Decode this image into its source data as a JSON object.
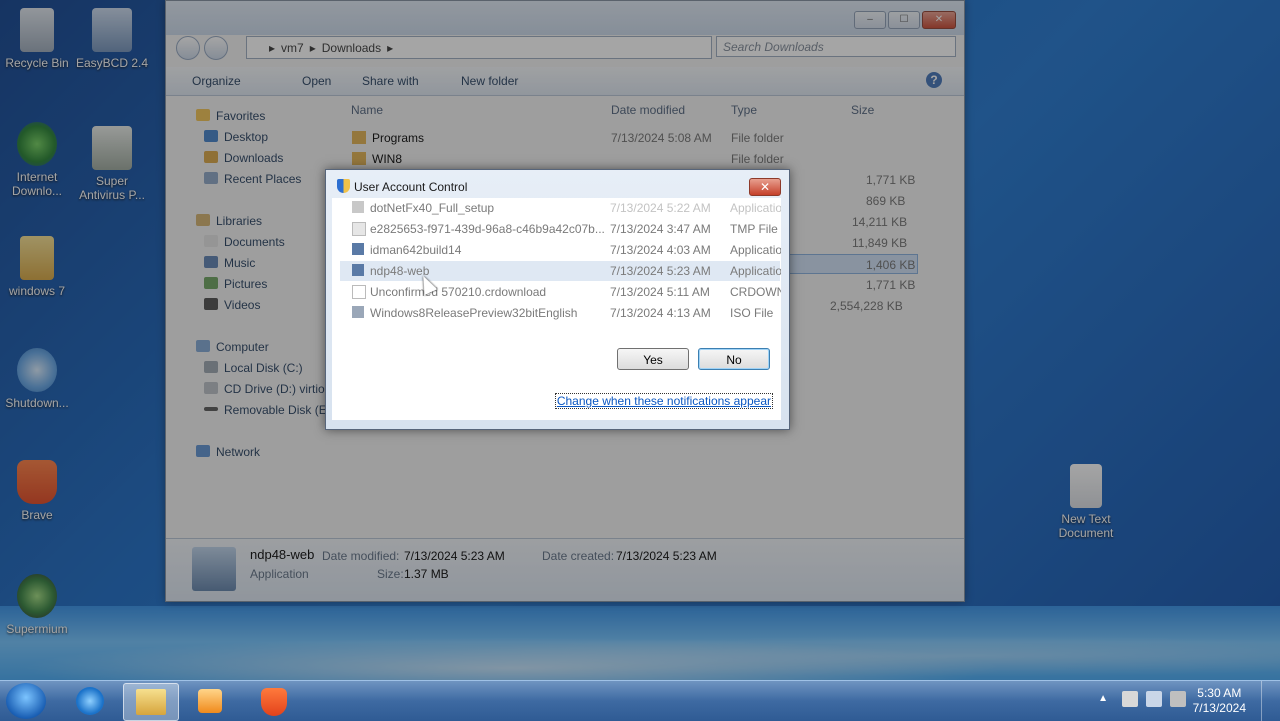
{
  "desktop": {
    "icons": [
      {
        "label": "Recycle Bin"
      },
      {
        "label": "EasyBCD 2.4"
      },
      {
        "label": "Internet Downlo..."
      },
      {
        "label": "Super Antivirus P..."
      },
      {
        "label": "windows 7"
      },
      {
        "label": "Shutdown..."
      },
      {
        "label": "Brave"
      },
      {
        "label": "Supermium"
      },
      {
        "label": "New Text Document"
      }
    ]
  },
  "explorer": {
    "breadcrumb": [
      "vm7",
      "Downloads"
    ],
    "search_placeholder": "Search Downloads",
    "toolbar": {
      "organize": "Organize",
      "open": "Open",
      "share_with": "Share with",
      "new_folder": "New folder"
    },
    "nav": {
      "favorites": "Favorites",
      "desktop": "Desktop",
      "downloads": "Downloads",
      "recent": "Recent Places",
      "libraries": "Libraries",
      "documents": "Documents",
      "music": "Music",
      "pictures": "Pictures",
      "videos": "Videos",
      "computer": "Computer",
      "local_disk": "Local Disk (C:)",
      "cd_drive": "CD Drive (D:) virtio",
      "removable": "Removable Disk (E:)",
      "network": "Network"
    },
    "columns": {
      "name": "Name",
      "date": "Date modified",
      "type": "Type",
      "size": "Size"
    },
    "rows": [
      {
        "name": "Programs",
        "date": "7/13/2024 5:08 AM",
        "type": "File folder",
        "size": ""
      },
      {
        "name": "WIN8",
        "date": "7/13/2024 5:02 AM",
        "type": "File folder",
        "size": ""
      },
      {
        "name": "",
        "date": "",
        "type": "",
        "size": "1,771 KB"
      },
      {
        "name": "dotNetFx40_Full_setup",
        "date": "7/13/2024 5:22 AM",
        "type": "Application",
        "size": "869 KB"
      },
      {
        "name": "e2825653-f971-439d-96a8-c46b9a42c07b...",
        "date": "7/13/2024 3:47 AM",
        "type": "TMP File",
        "size": "14,211 KB"
      },
      {
        "name": "idman642build14",
        "date": "7/13/2024 4:03 AM",
        "type": "Application",
        "size": "11,849 KB"
      },
      {
        "name": "ndp48-web",
        "date": "7/13/2024 5:23 AM",
        "type": "Application",
        "size": "1,406 KB"
      },
      {
        "name": "Unconfirmed 570210.crdownload",
        "date": "7/13/2024 5:11 AM",
        "type": "CRDOWNLOAD File",
        "size": "1,771 KB"
      },
      {
        "name": "Windows8ReleasePreview32bitEnglish",
        "date": "7/13/2024 4:13 AM",
        "type": "ISO File",
        "size": "2,554,228 KB"
      }
    ],
    "details": {
      "name": "ndp48-web",
      "kind": "Application",
      "modified_label": "Date modified:",
      "modified": "7/13/2024 5:23 AM",
      "created_label": "Date created:",
      "created": "7/13/2024 5:23 AM",
      "size_label": "Size:",
      "size": "1.37 MB"
    }
  },
  "uac": {
    "title": "User Account Control",
    "close": "✕",
    "yes": "Yes",
    "no": "No",
    "link": "Change when these notifications appear"
  },
  "taskbar": {
    "time": "5:30 AM",
    "date": "7/13/2024"
  }
}
